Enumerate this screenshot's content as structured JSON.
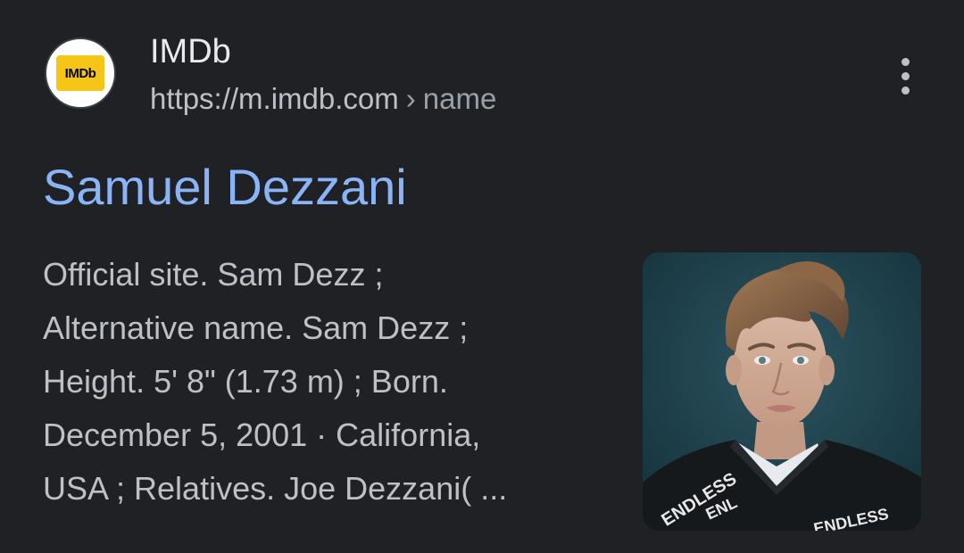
{
  "result": {
    "site_name": "IMDb",
    "favicon_label": "IMDb",
    "url_domain": "https://m.imdb.com",
    "url_separator": "›",
    "url_path": "name",
    "title": "Samuel Dezzani",
    "snippet_lines": [
      "Official site. Sam Dezz ;",
      "Alternative name. Sam Dezz ;",
      "Height. 5' 8\" (1.73 m) ; Born.",
      "December 5, 2001 · California,",
      "USA ; Relatives. Joe Dezzani( ..."
    ],
    "thumbnail_sweater_text": [
      "ENDLESS",
      "ENL",
      "ENDLESS"
    ]
  },
  "icons": {
    "favicon": "imdb-logo",
    "menu": "more-vert-icon"
  },
  "colors": {
    "background": "#202124",
    "title_link": "#8ab4f8",
    "text_primary": "#e8eaed",
    "text_secondary": "#bdc1c6",
    "imdb_yellow": "#f5c518"
  }
}
